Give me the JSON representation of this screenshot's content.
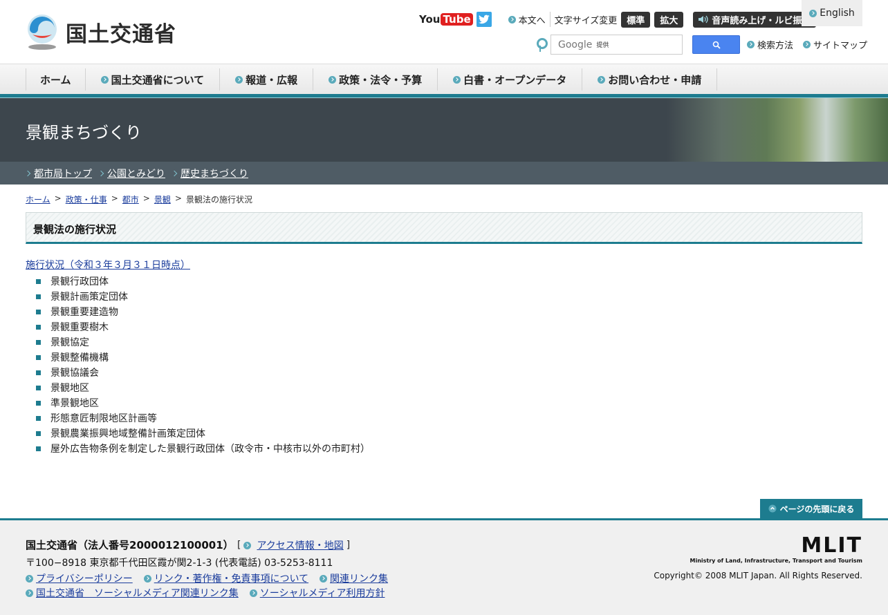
{
  "header": {
    "logo_text": "国土交通省",
    "youtube_you": "You",
    "youtube_tube": "Tube",
    "skip_link": "本文へ",
    "font_size_label": "文字サイズ変更",
    "font_standard": "標準",
    "font_large": "拡大",
    "voice": "音声読み上げ・ルビ振り",
    "english": "English",
    "search_placeholder": "Google",
    "search_provided": "提供",
    "search_method": "検索方法",
    "sitemap": "サイトマップ"
  },
  "nav": {
    "items": [
      {
        "label": "ホーム"
      },
      {
        "label": "国土交通省について"
      },
      {
        "label": "報道・広報"
      },
      {
        "label": "政策・法令・予算"
      },
      {
        "label": "白書・オープンデータ"
      },
      {
        "label": "お問い合わせ・申請"
      }
    ]
  },
  "banner": {
    "title": "景観まちづくり"
  },
  "subnav": {
    "items": [
      {
        "label": "都市局トップ"
      },
      {
        "label": "公園とみどり"
      },
      {
        "label": "歴史まちづくり"
      }
    ]
  },
  "breadcrumb": {
    "items": [
      {
        "label": "ホーム"
      },
      {
        "label": "政策・仕事"
      },
      {
        "label": "都市"
      },
      {
        "label": "景観"
      }
    ],
    "separator": ">",
    "current": "景観法の施行状況"
  },
  "page": {
    "title": "景観法の施行状況",
    "status_link": "施行状況（令和３年３月３１日時点）",
    "items": [
      "景観行政団体",
      "景観計画策定団体",
      "景観重要建造物",
      "景観重要樹木",
      "景観協定",
      "景観整備機構",
      "景観協議会",
      "景観地区",
      "準景観地区",
      "形態意匠制限地区計画等",
      "景観農業振興地域整備計画策定団体",
      "屋外広告物条例を制定した景観行政団体（政令市・中核市以外の市町村）"
    ],
    "to_top": "ページの先頭に戻る"
  },
  "footer": {
    "name": "国土交通省（法人番号2000012100001）",
    "bracket_open": "[",
    "bracket_close": "]",
    "access": "アクセス情報・地図",
    "address": "〒100−8918 東京都千代田区霞が関2-1-3 (代表電話) 03-5253-8111",
    "links_row1": [
      "プライバシーポリシー",
      "リンク・著作権・免責事項について",
      "関連リンク集"
    ],
    "links_row2": [
      "国土交通省　ソーシャルメディア関連リンク集",
      "ソーシャルメディア利用方針"
    ],
    "mlit_logo": "MLIT",
    "mlit_sub": "Ministry of Land, Infrastructure, Transport and Tourism",
    "copyright": "Copyright© 2008 MLIT Japan. All Rights Reserved."
  },
  "colors": {
    "accent": "#1d7c8f",
    "banner": "#3d464d",
    "subnav": "#4f5c65",
    "link": "#1a3c9c"
  }
}
